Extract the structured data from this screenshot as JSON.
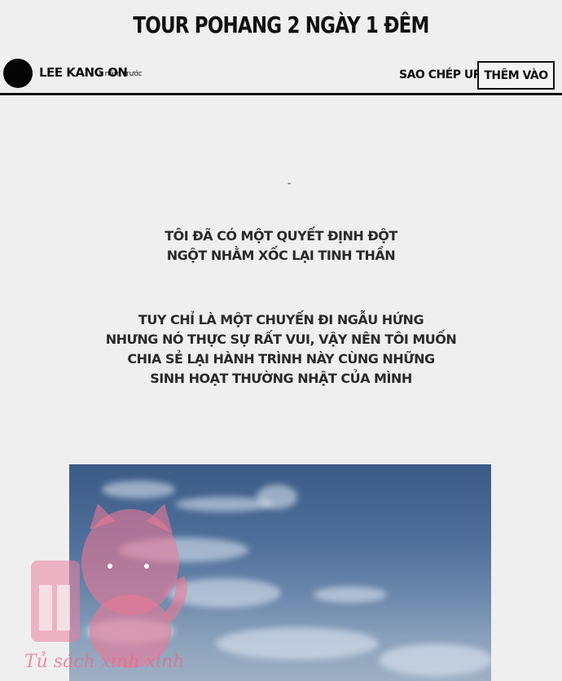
{
  "header": {
    "title": "TOUR POHANG 2 NGÀY 1 ĐÊM",
    "author": "LEE KANG ON",
    "time": "1 năm trước",
    "copy_url_label": "SAO CHÉP URL",
    "add_label": "THÊM VÀO"
  },
  "content": {
    "separator": "-",
    "paragraph1": [
      "TÔI ĐÃ CÓ MỘT QUYẾT ĐỊNH ĐỘT",
      "NGỘT NHẰM XỐC LẠI TINH THẦN"
    ],
    "paragraph2": [
      "TUY CHỈ LÀ MỘT CHUYẾN ĐI NGẪU HỨNG",
      "NHƯNG NÓ THỰC SỰ RẤT VUI, VẬY NÊN TÔI MUỐN",
      "CHIA SẺ LẠI HÀNH TRÌNH NÀY CÙNG NHỮNG",
      "SINH HOẠT THƯỜNG NHẬT CỦA MÌNH"
    ]
  },
  "watermark": {
    "text": "Tủ sách xinh xinh",
    "color": "#e86e8c"
  },
  "colors": {
    "background": "#efefef",
    "text": "#111111",
    "sky": "#4f6f9a"
  }
}
